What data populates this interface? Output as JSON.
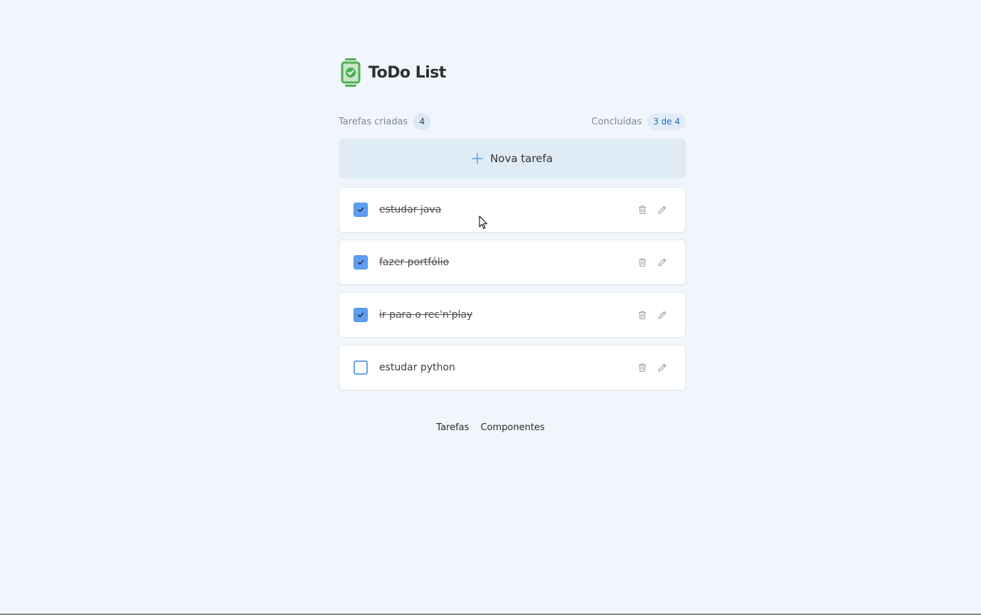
{
  "header": {
    "title": "ToDo List",
    "logo_icon": "checklist-logo-icon"
  },
  "stats": {
    "created_label": "Tarefas criadas",
    "created_count": "4",
    "done_label": "Concluídas",
    "done_count": "3 de 4"
  },
  "new_task": {
    "label": "Nova tarefa",
    "icon": "plus-icon"
  },
  "tasks": [
    {
      "text": "estudar java",
      "completed": true
    },
    {
      "text": "fazer portfólio",
      "completed": true
    },
    {
      "text": "ir para o rec'n'play",
      "completed": true
    },
    {
      "text": "estudar python",
      "completed": false
    }
  ],
  "footer": {
    "links": [
      "Tarefas",
      "Componentes"
    ]
  },
  "colors": {
    "background": "#f0f6fb",
    "accent": "#5e9ef0",
    "logo_green": "#4caf50"
  }
}
